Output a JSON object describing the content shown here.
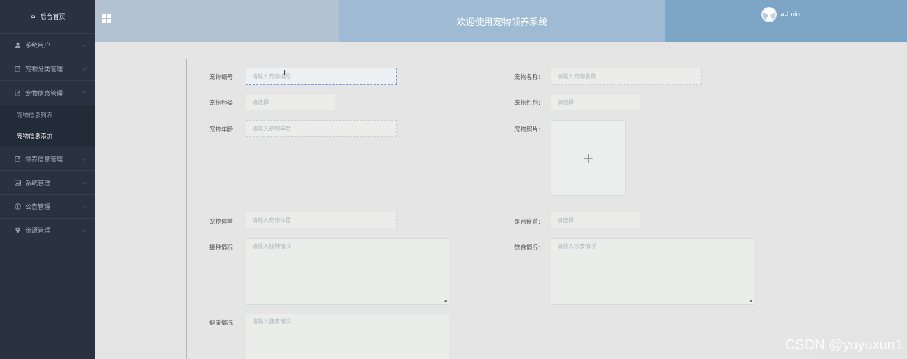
{
  "sidebar": {
    "home": "后台首页",
    "items": [
      {
        "label": "系统用户",
        "icon": "user-icon"
      },
      {
        "label": "宠物分类管理",
        "icon": "edit-icon"
      },
      {
        "label": "宠物信息管理",
        "icon": "edit-icon",
        "expanded": true,
        "children": [
          "宠物信息列表",
          "宠物信息添加"
        ]
      },
      {
        "label": "领养信息管理",
        "icon": "edit-icon"
      },
      {
        "label": "系统管理",
        "icon": "image-icon"
      },
      {
        "label": "公告管理",
        "icon": "info-icon"
      },
      {
        "label": "资源管理",
        "icon": "location-icon"
      }
    ]
  },
  "header": {
    "title": "欢迎使用宠物领养系统",
    "user": "admin"
  },
  "form": {
    "pet_no_label": "宠物编号:",
    "pet_no_ph": "请输入宠物编号",
    "pet_name_label": "宠物名称:",
    "pet_name_ph": "请输入宠物名称",
    "pet_type_label": "宠物种类:",
    "pet_type_ph": "请选择",
    "pet_gender_label": "宠物性别:",
    "pet_gender_ph": "请选择",
    "pet_age_label": "宠物年龄:",
    "pet_age_ph": "请输入宠物年龄",
    "pet_photo_label": "宠物照片:",
    "pet_weight_label": "宠物体重:",
    "pet_weight_ph": "请输入宠物体重",
    "vaccinated_label": "是否疫苗:",
    "vaccinated_ph": "请选择",
    "vaccination_label": "接种情况:",
    "vaccination_ph": "请输入接种情况",
    "diet_label": "饮食情况:",
    "diet_ph": "请输入饮食情况",
    "health_label": "健康情况:",
    "health_ph": "请输入健康情况"
  },
  "watermark": "CSDN @yuyuxun1"
}
